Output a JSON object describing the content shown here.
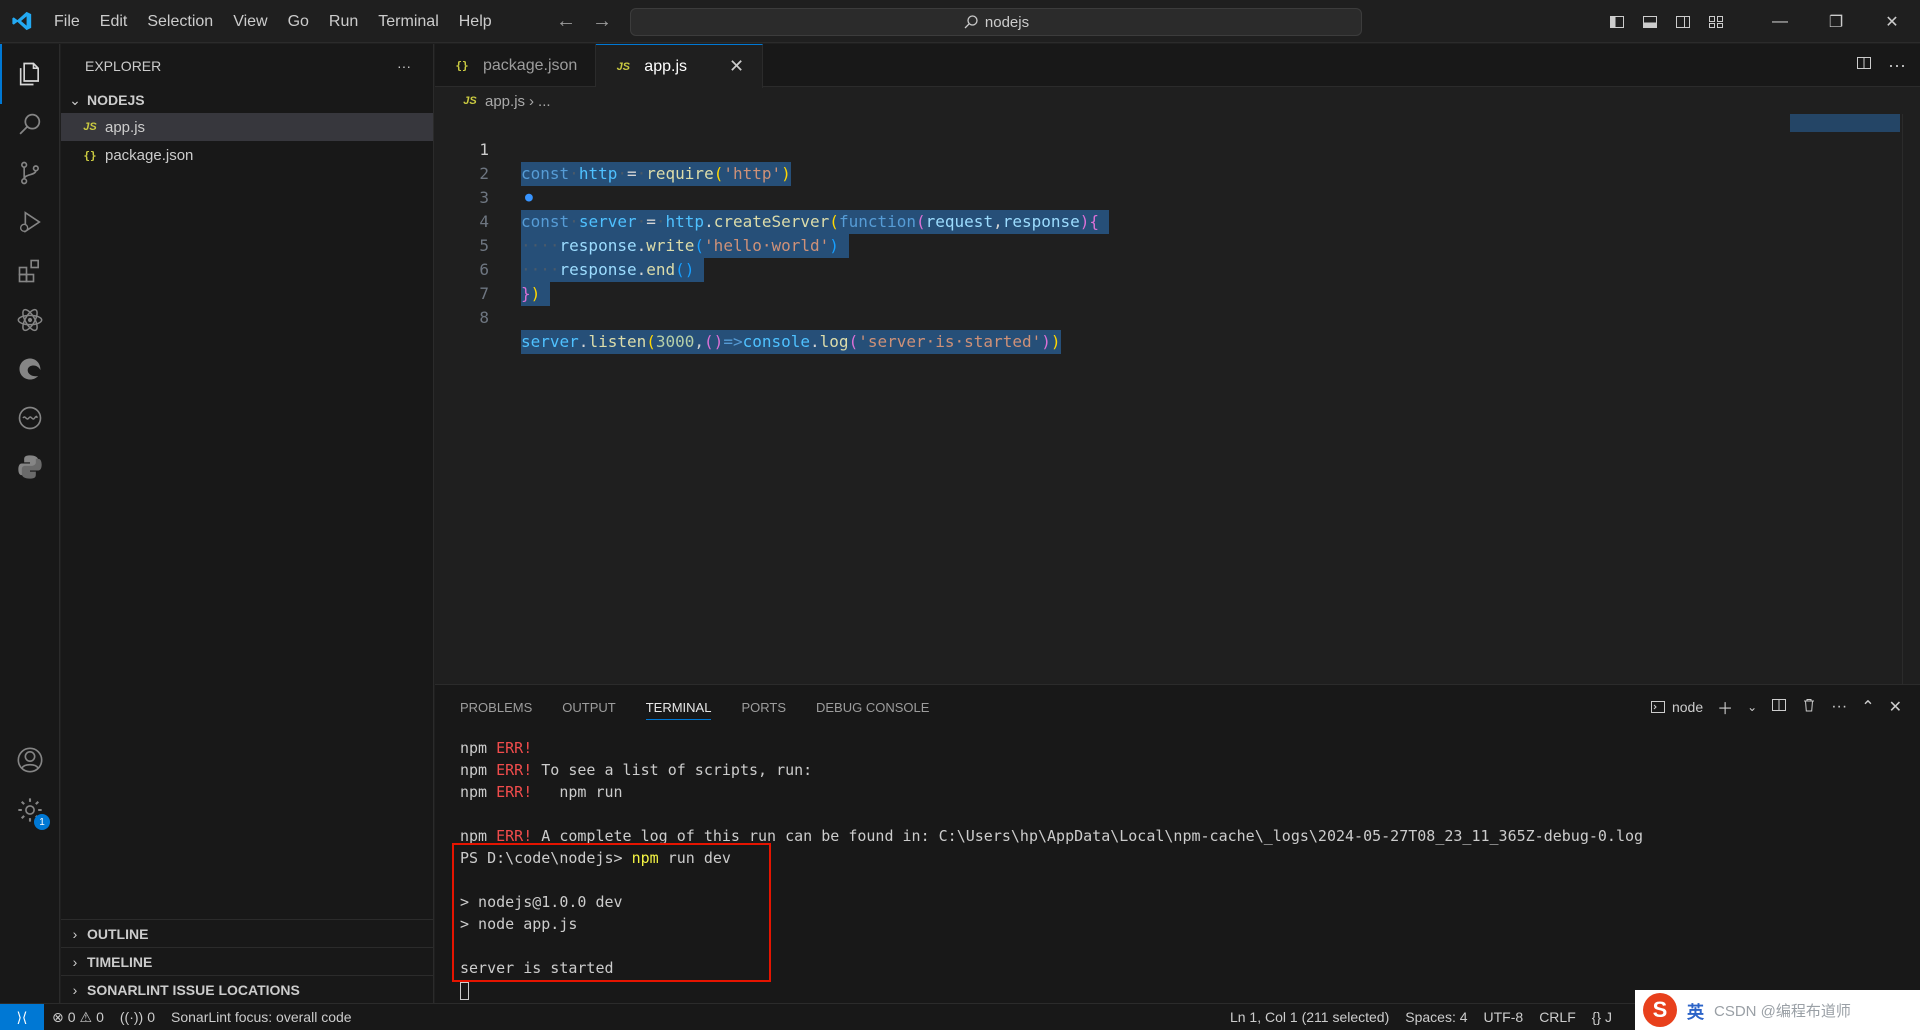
{
  "menu": [
    "File",
    "Edit",
    "Selection",
    "View",
    "Go",
    "Run",
    "Terminal",
    "Help"
  ],
  "search": {
    "label": "nodejs"
  },
  "explorer": {
    "header": "EXPLORER",
    "folder": "NODEJS",
    "files": [
      {
        "name": "app.js",
        "icon": "JS"
      },
      {
        "name": "package.json",
        "icon": "{}"
      }
    ],
    "bottom_sections": [
      "OUTLINE",
      "TIMELINE",
      "SONARLINT ISSUE LOCATIONS"
    ]
  },
  "tabs": [
    {
      "label": "package.json",
      "icon": "{}"
    },
    {
      "label": "app.js",
      "icon": "JS"
    }
  ],
  "breadcrumb": {
    "file": "app.js",
    "rest": "..."
  },
  "code": {
    "line_numbers": [
      "1",
      "2",
      "3",
      "4",
      "5",
      "6",
      "7",
      "8"
    ]
  },
  "panel": {
    "tabs": [
      "PROBLEMS",
      "OUTPUT",
      "TERMINAL",
      "PORTS",
      "DEBUG CONSOLE"
    ],
    "terminal_name": "node",
    "terminal_lines": {
      "l1_prefix": "npm ",
      "l1_err": "ERR!",
      "l2_prefix": "npm ",
      "l2_err": "ERR!",
      "l2_text": " To see a list of scripts, run:",
      "l3_prefix": "npm ",
      "l3_err": "ERR!",
      "l3_text": "   npm run",
      "l4_prefix": "npm ",
      "l4_err": "ERR!",
      "l4_text": " A complete log of this run can be found in: C:\\Users\\hp\\AppData\\Local\\npm-cache\\_logs\\2024-05-27T08_23_11_365Z-debug-0.log",
      "l5_prompt": "PS D:\\code\\nodejs> ",
      "l5_cmd": "npm",
      "l5_args": " run dev",
      "l6": "> nodejs@1.0.0 dev",
      "l7": "> node app.js",
      "l8": "server is started"
    }
  },
  "status": {
    "errors": "0",
    "warnings": "0",
    "ports": "0",
    "sonarlint": "SonarLint focus: overall code",
    "position": "Ln 1, Col 1 (211 selected)",
    "spaces": "Spaces: 4",
    "encoding": "UTF-8",
    "eol": "CRLF",
    "lang": "{} J"
  },
  "ime": {
    "s": "S",
    "lang": "英",
    "watermark": "CSDN @编程布道师"
  },
  "colors": {
    "accent": "#0078d4",
    "selection": "#264f78",
    "highlight_box": "#e51400"
  }
}
